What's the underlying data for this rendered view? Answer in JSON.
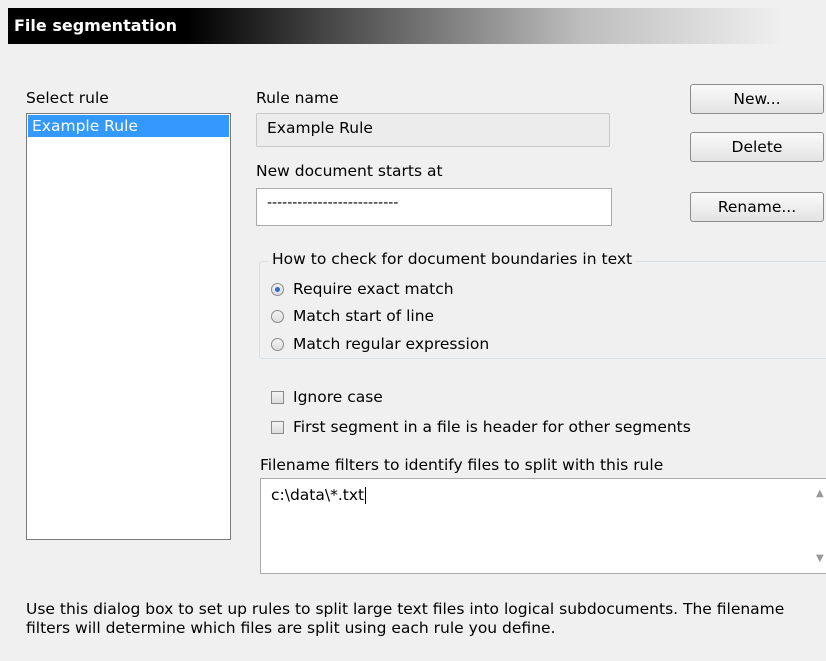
{
  "header": {
    "title": "File segmentation"
  },
  "select_rule": {
    "label": "Select rule",
    "items": [
      "Example Rule"
    ],
    "selected_index": 0
  },
  "rule_name": {
    "label": "Rule name",
    "value": "Example Rule"
  },
  "new_doc": {
    "label": "New document starts at",
    "value": "--------------------------"
  },
  "buttons": {
    "new": "New...",
    "delete": "Delete",
    "rename": "Rename..."
  },
  "boundaries": {
    "legend": "How to check for document boundaries in text",
    "options": [
      "Require exact match",
      "Match start of line",
      "Match regular expression"
    ],
    "selected_index": 0
  },
  "checks": {
    "ignore_case": {
      "label": "Ignore case",
      "checked": false
    },
    "first_segment": {
      "label": "First segment in a file is header for other segments",
      "checked": false
    }
  },
  "filters": {
    "label": "Filename filters to identify files to split with this rule",
    "value": "c:\\data\\*.txt"
  },
  "footer": {
    "text": "Use this dialog box to set up rules to split large text files into logical subdocuments.  The filename filters will determine which files are split using each rule you define."
  },
  "icons": {
    "scroll_up": "scroll-up-arrow-icon",
    "scroll_down": "scroll-down-arrow-icon"
  }
}
